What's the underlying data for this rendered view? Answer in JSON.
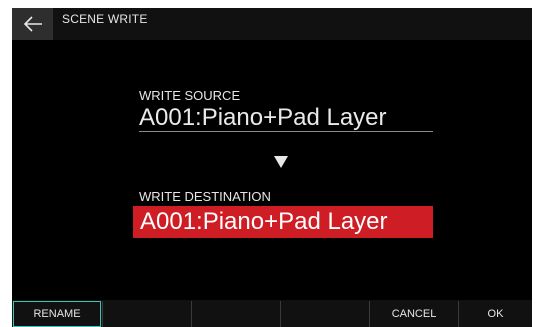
{
  "header": {
    "title": "SCENE WRITE",
    "back_icon": "back-arrow-icon"
  },
  "source": {
    "label": "WRITE SOURCE",
    "value": "A001:Piano+Pad Layer"
  },
  "destination": {
    "label": "WRITE DESTINATION",
    "value": "A001:Piano+Pad Layer"
  },
  "colors": {
    "accent": "#3cc5b4",
    "destination_highlight": "#cf1d26"
  },
  "function_bar": {
    "rename": "RENAME",
    "f2": "",
    "f3": "",
    "f4": "",
    "cancel": "CANCEL",
    "ok": "OK"
  }
}
